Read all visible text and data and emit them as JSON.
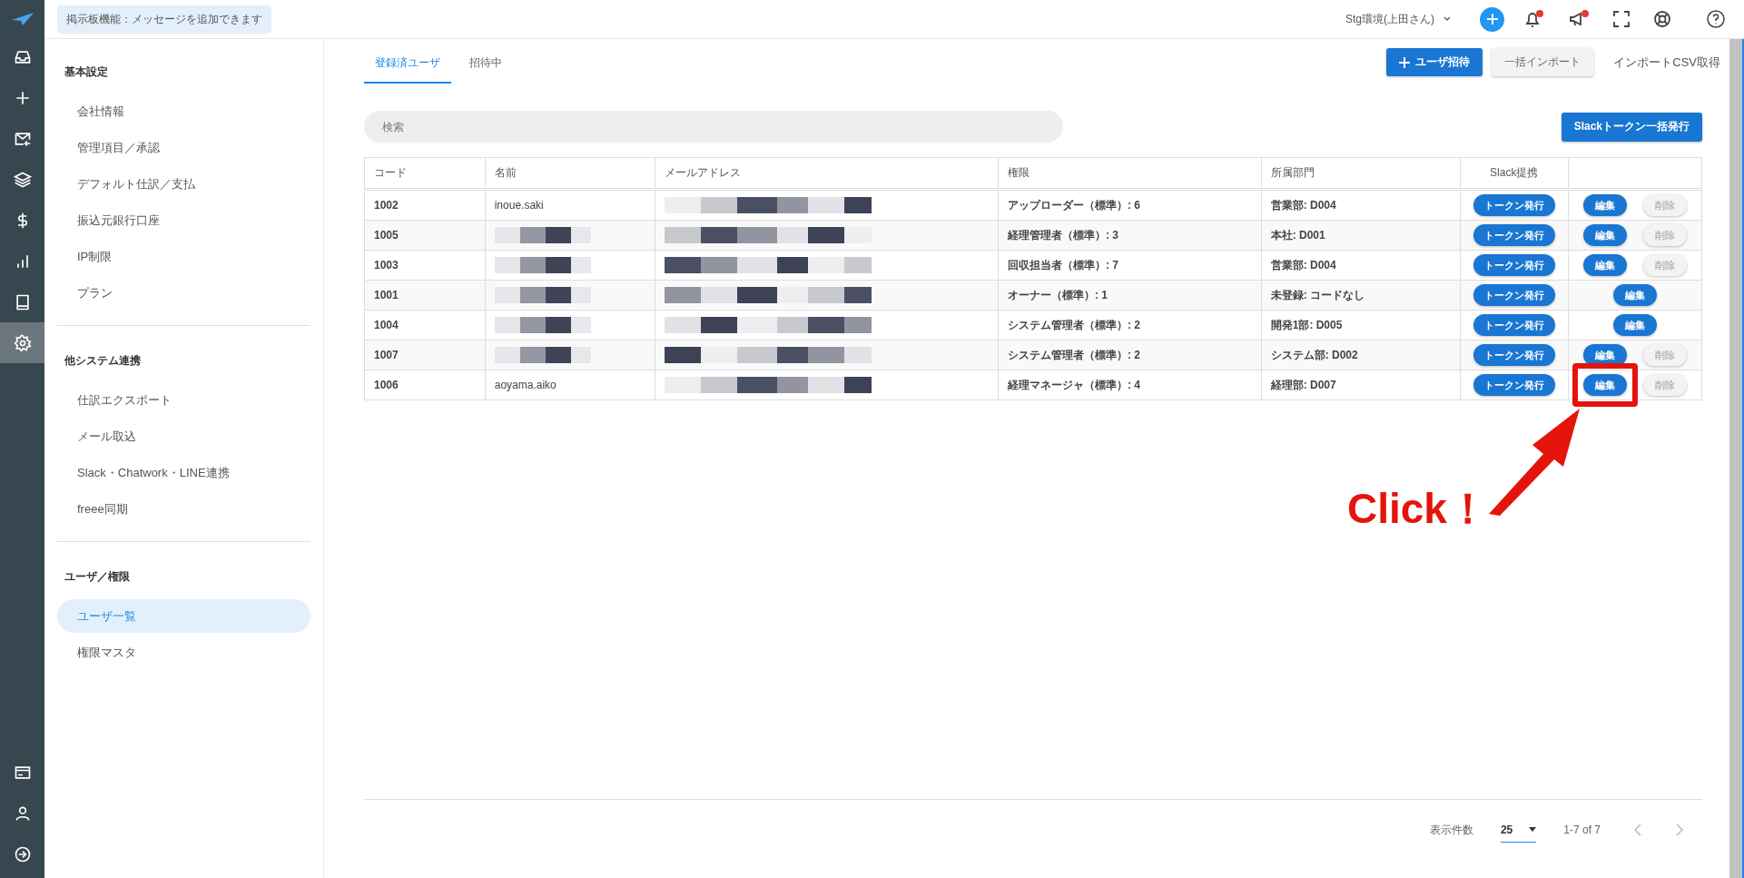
{
  "topbar": {
    "notice": "掲示板機能：メッセージを追加できます",
    "environment": "Stg環境(上田さん)",
    "notifications": [
      {
        "kind": "bell",
        "unread": true
      },
      {
        "kind": "megaphone",
        "unread": true
      }
    ]
  },
  "rail": {
    "items": [
      {
        "kind": "inbox",
        "selected": false
      },
      {
        "kind": "plus",
        "selected": false
      },
      {
        "kind": "mail",
        "selected": false
      },
      {
        "kind": "layers",
        "selected": false
      },
      {
        "kind": "dollar",
        "selected": false
      },
      {
        "kind": "chart",
        "selected": false
      },
      {
        "kind": "book",
        "selected": false
      },
      {
        "kind": "gear",
        "selected": true
      }
    ],
    "bottom": [
      {
        "kind": "card"
      },
      {
        "kind": "person"
      },
      {
        "kind": "logout"
      }
    ]
  },
  "sidebar": {
    "sections": [
      {
        "title": "基本設定",
        "items": [
          {
            "label": "会社情報",
            "selected": false
          },
          {
            "label": "管理項目／承認",
            "selected": false
          },
          {
            "label": "デフォルト仕訳／支払",
            "selected": false
          },
          {
            "label": "振込元銀行口座",
            "selected": false
          },
          {
            "label": "IP制限",
            "selected": false
          },
          {
            "label": "プラン",
            "selected": false
          }
        ]
      },
      {
        "title": "他システム連携",
        "items": [
          {
            "label": "仕訳エクスポート",
            "selected": false
          },
          {
            "label": "メール取込",
            "selected": false
          },
          {
            "label": "Slack・Chatwork・LINE連携",
            "selected": false
          },
          {
            "label": "freee同期",
            "selected": false
          }
        ]
      },
      {
        "title": "ユーザ／権限",
        "items": [
          {
            "label": "ユーザ一覧",
            "selected": true
          },
          {
            "label": "権限マスタ",
            "selected": false
          }
        ]
      }
    ]
  },
  "tabs": [
    {
      "label": "登録済ユーザ",
      "selected": true
    },
    {
      "label": "招待中",
      "selected": false
    }
  ],
  "actions": {
    "invite": "ユーザ招待",
    "import": "一括インポート",
    "csv": "インポートCSV取得",
    "slack_bulk": "Slackトークン一括発行"
  },
  "search": {
    "placeholder": "検索"
  },
  "table": {
    "columns": [
      "コード",
      "名前",
      "メールアドレス",
      "権限",
      "所属部門",
      "Slack提携"
    ],
    "rows": [
      {
        "code": "1002",
        "name": "inoue.saki",
        "email_hidden": true,
        "role": "アップローダー（標準）: 6",
        "dept": "営業部: D004",
        "token": "トークン発行",
        "edit": "編集",
        "delete": "削除",
        "highlighted": false
      },
      {
        "code": "1005",
        "name_hidden": true,
        "email_hidden": true,
        "role": "経理管理者（標準）: 3",
        "dept": "本社: D001",
        "token": "トークン発行",
        "edit": "編集",
        "delete": "削除",
        "highlighted": false
      },
      {
        "code": "1003",
        "name_hidden": true,
        "email_hidden": true,
        "role": "回収担当者（標準）: 7",
        "dept": "営業部: D004",
        "token": "トークン発行",
        "edit": "編集",
        "delete": "削除",
        "highlighted": false
      },
      {
        "code": "1001",
        "name_hidden": true,
        "email_hidden": true,
        "role": "オーナー（標準）: 1",
        "dept": "未登録: コードなし",
        "token": "トークン発行",
        "edit": "編集",
        "highlighted": false
      },
      {
        "code": "1004",
        "name_hidden": true,
        "email_hidden": true,
        "role": "システム管理者（標準）: 2",
        "dept": "開発1部: D005",
        "token": "トークン発行",
        "edit": "編集",
        "highlighted": false
      },
      {
        "code": "1007",
        "name_hidden": true,
        "email_hidden": true,
        "role": "システム管理者（標準）: 2",
        "dept": "システム部: D002",
        "token": "トークン発行",
        "edit": "編集",
        "delete": "削除",
        "highlighted": false
      },
      {
        "code": "1006",
        "name": "aoyama.aiko",
        "email_hidden": true,
        "role": "経理マネージャ（標準）: 4",
        "dept": "経理部: D007",
        "token": "トークン発行",
        "edit": "編集",
        "delete": "削除",
        "highlighted": true
      }
    ]
  },
  "pagination": {
    "label": "表示件数",
    "per_page": "25",
    "range": "1-7 of 7"
  },
  "annotation": {
    "text": "Click！"
  }
}
